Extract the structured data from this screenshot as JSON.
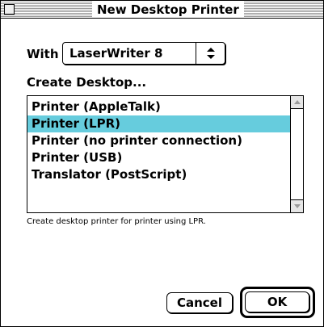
{
  "window": {
    "title": "New Desktop Printer"
  },
  "with_row": {
    "label": "With",
    "selected_value": "LaserWriter 8",
    "arrows_icon": "up-down-arrows-icon"
  },
  "section": {
    "label": "Create Desktop..."
  },
  "printer_types": {
    "items": [
      {
        "label": "Printer (AppleTalk)",
        "selected": false
      },
      {
        "label": "Printer (LPR)",
        "selected": true
      },
      {
        "label": "Printer (no printer connection)",
        "selected": false
      },
      {
        "label": "Printer (USB)",
        "selected": false
      },
      {
        "label": "Translator (PostScript)",
        "selected": false
      }
    ],
    "selection_color": "#66ccdd"
  },
  "description": "Create desktop printer for printer using LPR.",
  "buttons": {
    "cancel": "Cancel",
    "ok": "OK"
  }
}
